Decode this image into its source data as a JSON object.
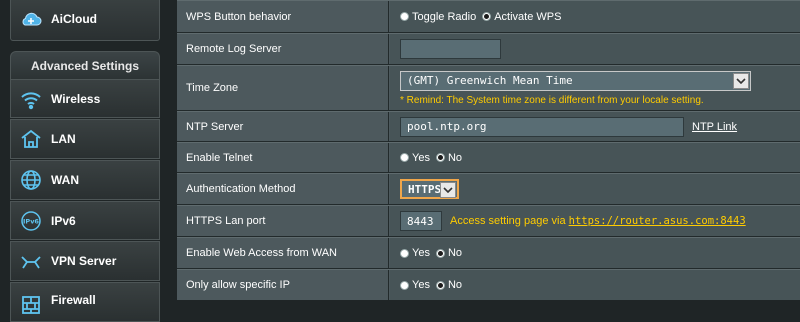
{
  "sidebar": {
    "aicloud_label": "AiCloud",
    "advanced_header": "Advanced Settings",
    "items": [
      {
        "label": "Wireless",
        "icon": "wifi-icon"
      },
      {
        "label": "LAN",
        "icon": "home-icon"
      },
      {
        "label": "WAN",
        "icon": "globe-icon"
      },
      {
        "label": "IPv6",
        "icon": "ipv6-icon"
      },
      {
        "label": "VPN Server",
        "icon": "vpn-icon"
      },
      {
        "label": "Firewall",
        "icon": "firewall-icon"
      }
    ]
  },
  "settings": {
    "wps_behavior": {
      "label": "WPS Button behavior",
      "options": [
        "Toggle Radio",
        "Activate WPS"
      ],
      "selected": "Activate WPS"
    },
    "remote_log": {
      "label": "Remote Log Server",
      "value": ""
    },
    "time_zone": {
      "label": "Time Zone",
      "value": "(GMT) Greenwich Mean Time",
      "remind": "* Remind: The System time zone is different from your locale setting."
    },
    "ntp": {
      "label": "NTP Server",
      "value": "pool.ntp.org",
      "link": "NTP Link"
    },
    "telnet": {
      "label": "Enable Telnet",
      "options": [
        "Yes",
        "No"
      ],
      "selected": "No"
    },
    "auth": {
      "label": "Authentication Method",
      "value": "HTTPS"
    },
    "https_port": {
      "label": "HTTPS Lan port",
      "value": "8443",
      "hint": "Access setting page via",
      "url": "https://router.asus.com:8443"
    },
    "web_access_wan": {
      "label": "Enable Web Access from WAN",
      "options": [
        "Yes",
        "No"
      ],
      "selected": "No"
    },
    "specific_ip": {
      "label": "Only allow specific IP",
      "options": [
        "Yes",
        "No"
      ],
      "selected": "No"
    }
  },
  "colors": {
    "accent": "#ffcc00",
    "panel": "#4d595d",
    "sidebar": "#1f2526"
  }
}
